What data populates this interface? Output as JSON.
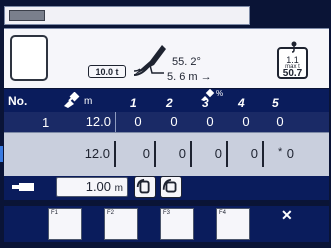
{
  "info": {
    "weight_badge": "10.0 t",
    "angle": "55. 2°",
    "radius": "5. 6 m",
    "radius_arrow": "→",
    "max_small": "1.1",
    "max_label": "max t",
    "max_value": "50.7"
  },
  "table": {
    "header": {
      "no": "No.",
      "unit": "m",
      "columns": [
        "1",
        "2",
        "3",
        "4",
        "5"
      ],
      "pct": "%"
    },
    "row1": {
      "no": "1",
      "value": "12.0",
      "cells": [
        "0",
        "0",
        "0",
        "0",
        "0"
      ]
    },
    "row2": {
      "value": "12.0",
      "cells": [
        "0",
        "0",
        "0",
        "0",
        "0"
      ],
      "star": "*"
    }
  },
  "controls": {
    "length_value": "1.00",
    "length_unit": "m"
  },
  "function_keys": [
    "F1",
    "F2",
    "F3",
    "F4"
  ],
  "close_symbol": "✕",
  "icons": [
    "crane-icon",
    "hook-icon",
    "satellite-icon",
    "telescopic-arm-icon",
    "rotate-icon",
    "swing-icon",
    "close-icon"
  ],
  "colors": {
    "background": "#0a1436",
    "panel": "#0a1c5c",
    "highlight": "#3a7be0"
  }
}
